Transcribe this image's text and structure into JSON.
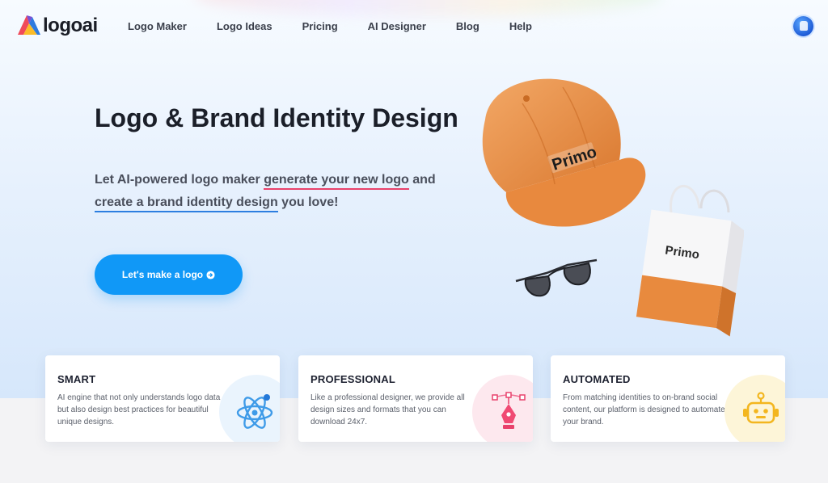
{
  "brand": {
    "name": "logoai"
  },
  "nav": {
    "links": [
      "Logo Maker",
      "Logo Ideas",
      "Pricing",
      "AI Designer",
      "Blog",
      "Help"
    ]
  },
  "hero": {
    "title": "Logo & Brand Identity Design",
    "sub_part1": "Let AI-powered logo maker ",
    "sub_highlight1": "generate your new logo",
    "sub_part2": " and ",
    "sub_highlight2": "create a brand identity design",
    "sub_part3": " you love!",
    "cta_label": "Let's make a logo",
    "product_brand": "Primo"
  },
  "features": [
    {
      "title": "SMART",
      "description": "AI engine that not only understands logo data but also design best practices for beautiful unique designs.",
      "icon": "atom-icon",
      "circle_color": "#eaf4fd"
    },
    {
      "title": "PROFESSIONAL",
      "description": "Like a professional designer, we provide all design sizes and formats that you can download 24x7.",
      "icon": "pen-tool-icon",
      "circle_color": "#fde8ee"
    },
    {
      "title": "AUTOMATED",
      "description": "From matching identities to on-brand social content, our platform is designed to automate your brand.",
      "icon": "robot-icon",
      "circle_color": "#fdf5d8"
    }
  ],
  "colors": {
    "accent": "#1098f7",
    "underline_red": "#e8416b",
    "underline_blue": "#2c7ee0"
  }
}
